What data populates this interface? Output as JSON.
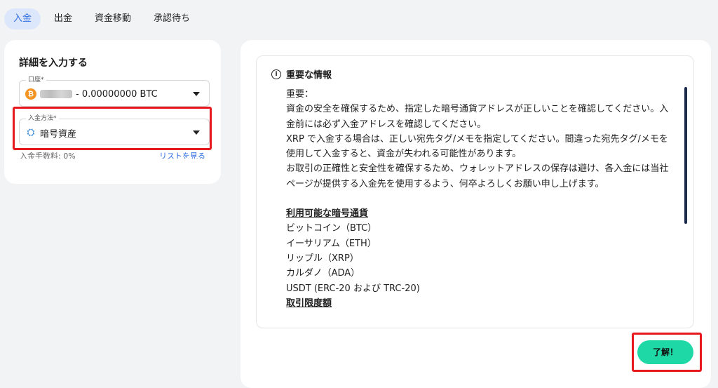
{
  "tabs": [
    {
      "label": "入金",
      "active": true
    },
    {
      "label": "出金",
      "active": false
    },
    {
      "label": "資金移動",
      "active": false
    },
    {
      "label": "承認待ち",
      "active": false
    }
  ],
  "left": {
    "title": "詳細を入力する",
    "account": {
      "label": "口座*",
      "icon": "bitcoin-icon",
      "value": "- 0.00000000 BTC"
    },
    "method": {
      "label": "入金方法*",
      "icon": "crypto-asset-icon",
      "value": "暗号資産"
    },
    "fee_text": "入金手数料: 0%",
    "list_link": "リストを見る"
  },
  "info": {
    "title": "重要な情報",
    "paragraphs": [
      "重要：",
      "資金の安全を確保するため、指定した暗号通貨アドレスが正しいことを確認してください。入金前には必ず入金アドレスを確認してください。",
      "XRP で入金する場合は、正しい宛先タグ/メモを指定してください。間違った宛先タグ/メモを使用して入金すると、資金が失われる可能性があります。",
      "お取引の正確性と安全性を確保するため、ウォレットアドレスの保存は避け、各入金には当社ページが提供する入金先を使用するよう、何卒よろしくお願い申し上げます。"
    ],
    "available_title": "利用可能な暗号通貨",
    "coins": [
      "ビットコイン（BTC）",
      "イーサリアム（ETH）",
      "リップル（XRP）",
      "カルダノ（ADA）",
      "USDT (ERC-20 および TRC-20)"
    ],
    "limit_title": "取引限度額"
  },
  "ok_button": "了解！",
  "colors": {
    "accent": "#1ed9a6",
    "highlight": "#e8191e",
    "tab_active": "#2f6fe0"
  }
}
